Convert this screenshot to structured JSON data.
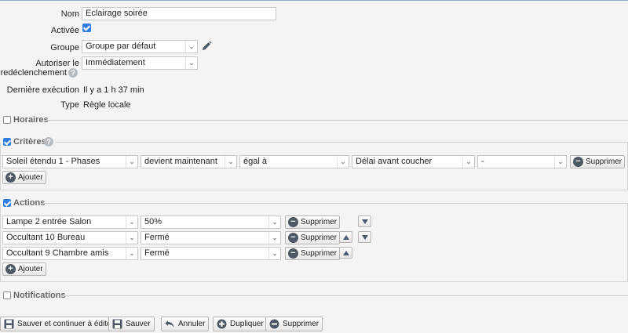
{
  "form": {
    "nom_label": "Nom",
    "nom_value": "Eclairage soirée",
    "activee_label": "Activée",
    "groupe_label": "Groupe",
    "groupe_value": "Groupe par défaut",
    "redeclenchement_label_1": "Autoriser le",
    "redeclenchement_label_2": "redéclenchement",
    "redeclenchement_value": "Immédiatement",
    "derniere_label": "Dernière exécution",
    "derniere_value": "Il y a 1 h 37 min",
    "type_label": "Type",
    "type_value": "Règle locale"
  },
  "sections": {
    "horaires": "Horaires",
    "criteres": "Critères",
    "actions": "Actions",
    "notifications": "Notifications"
  },
  "criteres": {
    "row": {
      "device": "Soleil étendu 1 - Phases",
      "event": "devient maintenant",
      "operator": "égal à",
      "value": "Délai avant coucher",
      "extra": "-"
    },
    "remove_label": "Supprimer",
    "add_label": "Ajouter"
  },
  "actions": {
    "rows": [
      {
        "device": "Lampe 2 entrée Salon",
        "value": "50%"
      },
      {
        "device": "Occultant 10 Bureau",
        "value": "Fermé"
      },
      {
        "device": "Occultant 9 Chambre amis",
        "value": "Fermé"
      }
    ],
    "remove_label": "Supprimer",
    "add_label": "Ajouter"
  },
  "footer": {
    "save_continue": "Sauver et continuer à éditer",
    "save": "Sauver",
    "cancel": "Annuler",
    "duplicate": "Dupliquer",
    "delete": "Supprimer"
  },
  "icons": {
    "edit": "pencil-icon",
    "help": "question-icon",
    "remove": "minus-circle-icon",
    "add": "plus-circle-icon",
    "save": "floppy-icon",
    "cancel": "undo-icon",
    "duplicate": "plus-circle-icon"
  },
  "colors": {
    "accent": "#2f7de1",
    "icon": "#4d5866"
  }
}
